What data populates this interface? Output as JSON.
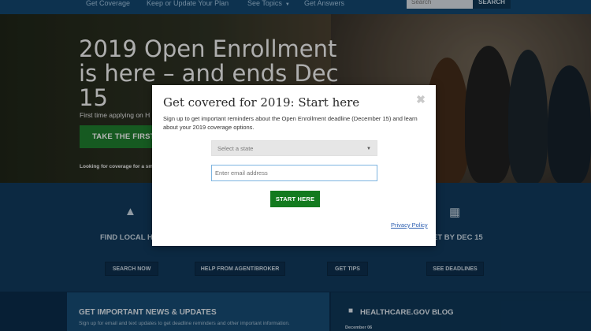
{
  "nav": {
    "links": [
      "Get Coverage",
      "Keep or Update Your Plan",
      "See Topics",
      "Get Answers"
    ],
    "search_placeholder": "Search",
    "search_button": "SEARCH"
  },
  "hero": {
    "title": "2019 Open Enrollment is here – and ends Dec 15",
    "subtitle": "First time applying on H",
    "cta": "TAKE THE FIRST S",
    "small_text": "Looking for coverage for a sm"
  },
  "features": {
    "left_title": "FIND LOCAL H",
    "right_title": "ET BY DEC 15",
    "buttons": [
      "SEARCH NOW",
      "HELP FROM AGENT/BROKER",
      "GET TIPS",
      "SEE DEADLINES"
    ]
  },
  "news": {
    "title": "GET IMPORTANT NEWS & UPDATES",
    "subtitle": "Sign up for email and text updates to get deadline reminders and other important information."
  },
  "blog": {
    "title": "HEALTHCARE.GOV BLOG",
    "date": "December 06"
  },
  "modal": {
    "title": "Get covered for 2019: Start here",
    "close": "✖",
    "description": "Sign up to get important reminders about the Open Enrollment deadline (December 15) and learn about your 2019 coverage options.",
    "state_placeholder": "Select a state",
    "email_placeholder": "Enter email address",
    "submit": "START HERE",
    "privacy": "Privacy Policy"
  },
  "colors": {
    "nav_bg": "#12466e",
    "feature_bg": "#113a5c",
    "cta_green": "#1f7d2e",
    "modal_button_green": "#137a1f",
    "link_blue": "#2a5db0"
  }
}
